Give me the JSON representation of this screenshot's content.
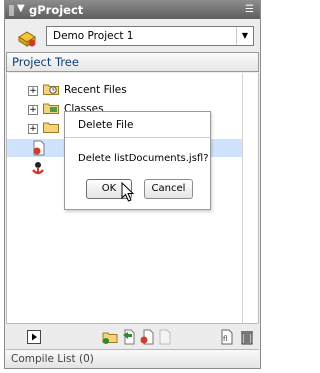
{
  "panel": {
    "title": "gProject"
  },
  "project": {
    "selected": "Demo Project 1"
  },
  "tree": {
    "header": "Project Tree",
    "rows": [
      {
        "label": "Recent Files"
      },
      {
        "label": "Classes"
      },
      {
        "label": ""
      },
      {
        "label": ""
      },
      {
        "label": ""
      }
    ]
  },
  "dialog": {
    "title": "Delete File",
    "message": "Delete listDocuments.jsfl?",
    "ok_label": "OK",
    "cancel_label": "Cancel"
  },
  "compile": {
    "label": "Compile List (0)"
  },
  "colors": {
    "titlebar": "#6d6d6d",
    "header_text": "#0b3d77",
    "selection": "#cfe3ff"
  },
  "icons": [
    "grip-icon",
    "collapse-arrow-icon",
    "panel-menu-icon",
    "project-icon",
    "folder-icon",
    "classes-icon",
    "document-icon",
    "flash-icon"
  ]
}
